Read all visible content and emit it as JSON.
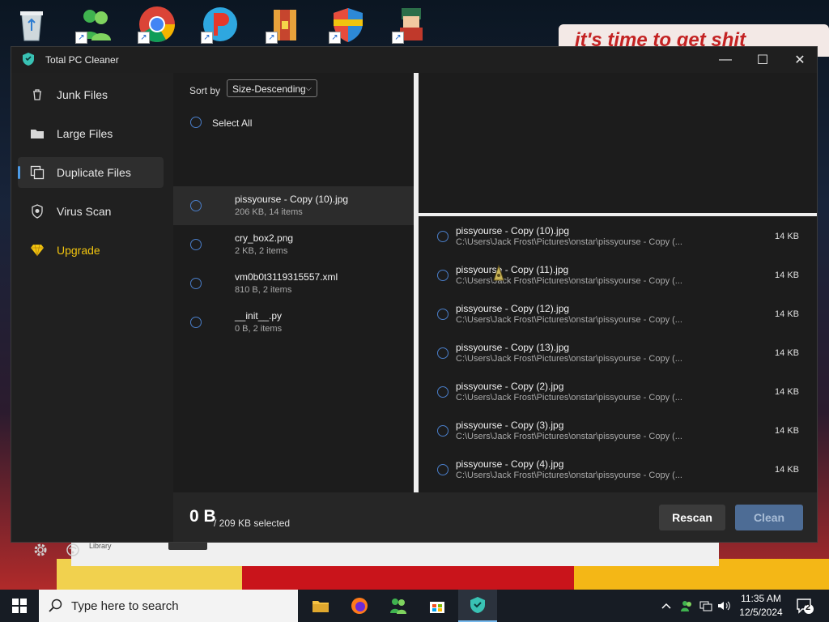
{
  "desktop": {
    "poster_text": "it's time to get shit",
    "bg_window_tag": "Library"
  },
  "app": {
    "title": "Total PC Cleaner",
    "nav": [
      {
        "label": "Junk Files"
      },
      {
        "label": "Large Files"
      },
      {
        "label": "Duplicate Files",
        "active": true
      },
      {
        "label": "Virus Scan"
      },
      {
        "label": "Upgrade"
      }
    ],
    "sort": {
      "label": "Sort by",
      "value": "Size-Descending"
    },
    "select_all": "Select All",
    "groups": [
      {
        "name": "pissyourse - Copy (10).jpg",
        "meta": "206 KB, 14 items"
      },
      {
        "name": "cry_box2.png",
        "meta": "2 KB, 2 items"
      },
      {
        "name": "vm0b0t3119315557.xml",
        "meta": "810 B, 2 items"
      },
      {
        "name": "__init__.py",
        "meta": "0 B, 2 items"
      }
    ],
    "files": [
      {
        "name": "pissyourse - Copy (10).jpg",
        "path": "C:\\Users\\Jack Frost\\Pictures\\onstar\\pissyourse - Copy (...",
        "size": "14 KB"
      },
      {
        "name": "pissyourse - Copy (11).jpg",
        "path": "C:\\Users\\Jack Frost\\Pictures\\onstar\\pissyourse - Copy (...",
        "size": "14 KB"
      },
      {
        "name": "pissyourse - Copy (12).jpg",
        "path": "C:\\Users\\Jack Frost\\Pictures\\onstar\\pissyourse - Copy (...",
        "size": "14 KB"
      },
      {
        "name": "pissyourse - Copy (13).jpg",
        "path": "C:\\Users\\Jack Frost\\Pictures\\onstar\\pissyourse - Copy (...",
        "size": "14 KB"
      },
      {
        "name": "pissyourse - Copy (2).jpg",
        "path": "C:\\Users\\Jack Frost\\Pictures\\onstar\\pissyourse - Copy (...",
        "size": "14 KB"
      },
      {
        "name": "pissyourse - Copy (3).jpg",
        "path": "C:\\Users\\Jack Frost\\Pictures\\onstar\\pissyourse - Copy (...",
        "size": "14 KB"
      },
      {
        "name": "pissyourse - Copy (4).jpg",
        "path": "C:\\Users\\Jack Frost\\Pictures\\onstar\\pissyourse - Copy (...",
        "size": "14 KB"
      }
    ],
    "footer": {
      "selected_value": "0 B",
      "selected_total": "/ 209 KB selected",
      "rescan_label": "Rescan",
      "clean_label": "Clean"
    },
    "window_controls": {
      "minimize": "—",
      "maximize": "☐",
      "close": "✕"
    }
  },
  "taskbar": {
    "search_placeholder": "Type here to search",
    "time": "11:35 AM",
    "date": "12/5/2024",
    "notification_count": "2"
  },
  "colors": {
    "accent": "#4c9ae6",
    "upgrade": "#f1c40f",
    "clean_button": "#4d6c95"
  }
}
